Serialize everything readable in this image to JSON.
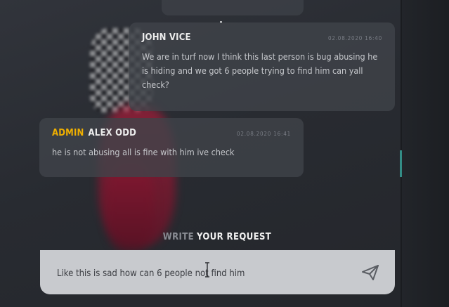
{
  "messages": [
    {
      "role": "",
      "author": "JOHN VICE",
      "timestamp": "02.08.2020 16:40",
      "text": "We are in turf now I think this last person is bug abusing he is hiding and we got 6 people trying to find him can yall check?"
    },
    {
      "role": "ADMIN",
      "author": "ALEX ODD",
      "timestamp": "02.08.2020 16:41",
      "text": "he is not abusing all is fine with him ive check"
    }
  ],
  "composer": {
    "heading_prefix": "WRITE",
    "heading_main": "YOUR REQUEST",
    "value": "Like this is sad how can 6 people not find him",
    "send_icon": "paper-plane-icon"
  },
  "colors": {
    "admin_role": "#f0b000",
    "accent": "#3aa79f",
    "input_bg": "#c8cace"
  }
}
